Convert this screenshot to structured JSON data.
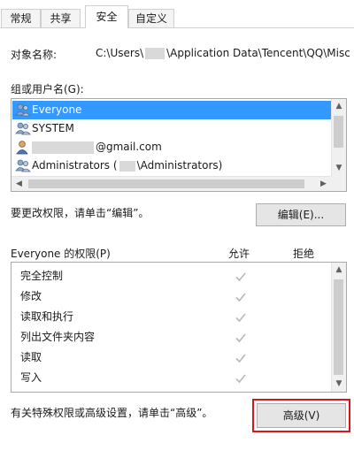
{
  "tabs": [
    {
      "label": "常规",
      "active": false
    },
    {
      "label": "共享",
      "active": false
    },
    {
      "label": "安全",
      "active": true
    },
    {
      "label": "自定义",
      "active": false
    }
  ],
  "object": {
    "label": "对象名称:",
    "path": "C:\\Users\\",
    "path_rest": "\\Application Data\\Tencent\\QQ\\Misc"
  },
  "groups": {
    "label": "组或用户名(G):",
    "items": [
      {
        "name": "Everyone",
        "selected": true,
        "icon": "group-users-icon"
      },
      {
        "name": "SYSTEM",
        "selected": false,
        "icon": "group-users-icon"
      },
      {
        "name": "@gmail.com",
        "selected": false,
        "icon": "single-user-icon"
      },
      {
        "name": "Administrators (",
        "suffix": "\\Administrators)",
        "selected": false,
        "icon": "group-users-icon"
      }
    ]
  },
  "edit": {
    "hint": "要更改权限，请单击“编辑”。",
    "button_label": "编辑(E)..."
  },
  "permissions": {
    "title": "Everyone 的权限(P)",
    "allow_header": "允许",
    "deny_header": "拒绝",
    "rows": [
      {
        "name": "完全控制",
        "allow": true,
        "deny": false
      },
      {
        "name": "修改",
        "allow": true,
        "deny": false
      },
      {
        "name": "读取和执行",
        "allow": true,
        "deny": false
      },
      {
        "name": "列出文件夹内容",
        "allow": true,
        "deny": false
      },
      {
        "name": "读取",
        "allow": true,
        "deny": false
      },
      {
        "name": "写入",
        "allow": true,
        "deny": false
      }
    ]
  },
  "advanced": {
    "hint": "有关特殊权限或高级设置，请单击“高级”。",
    "button_label": "高级(V)"
  },
  "colors": {
    "selection": "#3399ff",
    "highlight_box": "#d5161d",
    "check_disabled": "#b8b8b8"
  }
}
